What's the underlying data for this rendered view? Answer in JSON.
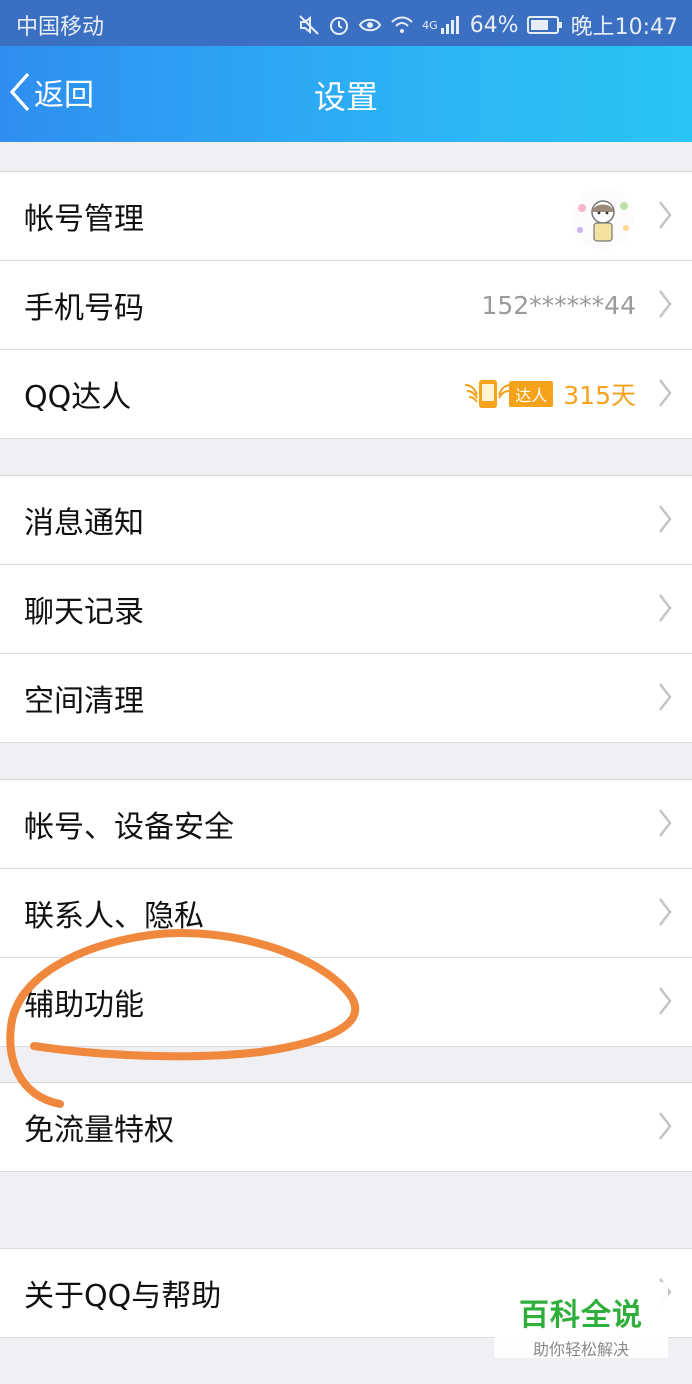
{
  "status_bar": {
    "carrier": "中国移动",
    "network": "4G",
    "battery": "64%",
    "time": "晚上10:47",
    "icons": [
      "mute-icon",
      "alarm-icon",
      "eye-icon",
      "wifi-icon",
      "signal-icon",
      "battery-icon"
    ]
  },
  "nav": {
    "back_label": "返回",
    "title": "设置"
  },
  "groups": [
    {
      "rows": [
        {
          "label": "帐号管理",
          "accessory": "avatar"
        },
        {
          "label": "手机号码",
          "value": "152******44"
        },
        {
          "label": "QQ达人",
          "badge_text": "达人",
          "value": "315天"
        }
      ]
    },
    {
      "rows": [
        {
          "label": "消息通知"
        },
        {
          "label": "聊天记录"
        },
        {
          "label": "空间清理"
        }
      ]
    },
    {
      "rows": [
        {
          "label": "帐号、设备安全"
        },
        {
          "label": "联系人、隐私"
        },
        {
          "label": "辅助功能",
          "highlighted": true
        },
        {
          "label": "免流量特权"
        }
      ]
    },
    {
      "rows": [
        {
          "label": "关于QQ与帮助"
        }
      ]
    }
  ],
  "annotation": {
    "color": "#f0883e",
    "target": "辅助功能"
  },
  "watermark": {
    "title": "百科全说",
    "subtitle": "助你轻松解决"
  },
  "colors": {
    "nav_start": "#2f8ef0",
    "nav_end": "#2ac4f4",
    "daren": "#f6a21b",
    "watermark": "#2fae3b"
  }
}
